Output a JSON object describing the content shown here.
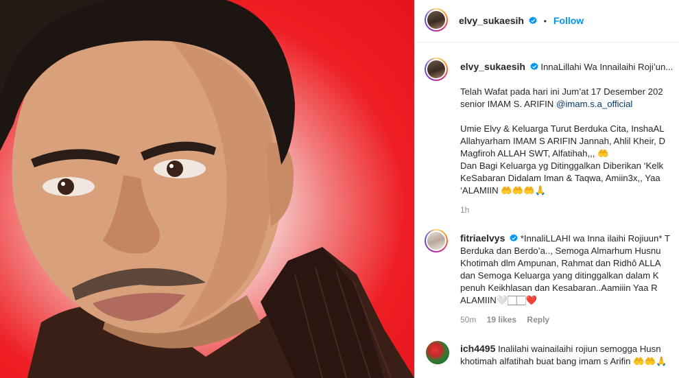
{
  "colors": {
    "background_red": "#e3141a",
    "link_blue": "#0095f6",
    "mention_blue": "#00376b",
    "verified_blue": "#0095f6",
    "meta_gray": "#8e8e8e",
    "text": "#262626"
  },
  "post": {
    "photo_alt": "portrait photo of a man in front of a red background"
  },
  "header": {
    "username": "elvy_sukaesih",
    "separator": "•",
    "follow_label": "Follow"
  },
  "caption": {
    "username": "elvy_sukaesih",
    "lines": [
      "InnaLillahi Wa Innailaihi Roji’un...",
      "",
      "Telah Wafat pada hari ini Jum’at 17 Desember 202",
      "senior IMAM S. ARIFIN",
      "",
      "Umie Elvy & Keluarga Turut Berduka Cita, InshaAL",
      "Allahyarham IMAM S ARIFIN Jannah, Ahlil Kheir, D",
      "Magfiroh ALLAH SWT, Alfatihah,,, 🤲",
      "Dan Bagi Keluarga yg Ditinggalkan Diberikan ‘Kelk",
      "KeSabaran Didalam Iman & Taqwa, Amiin3x,, Yaa",
      "‘ALAMIIN 🤲🤲🤲🙏"
    ],
    "mention": "@imam.s.a_official",
    "time": "1h"
  },
  "comments": [
    {
      "username": "fitriaelvys",
      "lines": [
        "*InnaliLLAHI wa Inna ilaihi Rojiuun* T",
        "Berduka dan Berdo’a.., Semoga Almarhum Husnu",
        "Khotimah dlm Ampunan, Rahmat dan Ridhô ALLA",
        "dan Semoga Keluarga yang ditinggalkan dalam K",
        "penuh Keikhlasan dan Kesabaran..Aamiiin Yaa R",
        "ALAMIIN🤍🏻🏻❤️"
      ],
      "time": "50m",
      "likes": "19 likes",
      "reply_label": "Reply"
    },
    {
      "username": "ich4495",
      "lines": [
        "Inalilahi wainailaihi rojiun semogga Husn",
        "khotimah alfatihah buat bang imam s Arifin 🤲🤲🙏"
      ]
    }
  ],
  "icons": {
    "verified": "verified-badge-icon"
  }
}
